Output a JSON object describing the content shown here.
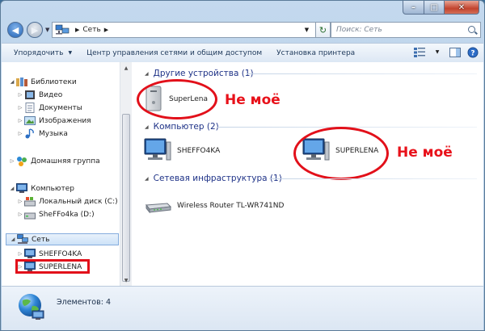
{
  "window": {
    "controls": {
      "minimize": "–",
      "maximize": "□",
      "close": "✕"
    }
  },
  "address_bar": {
    "breadcrumb": [
      "Сеть"
    ],
    "search_placeholder": "Поиск: Сеть"
  },
  "toolbar": {
    "organize_label": "Упорядочить",
    "network_center_label": "Центр управления сетями и общим доступом",
    "add_printer_label": "Установка принтера"
  },
  "nav_pane": {
    "libraries": {
      "label": "Библиотеки",
      "items": [
        {
          "label": "Видео",
          "icon": "video-library-icon"
        },
        {
          "label": "Документы",
          "icon": "documents-library-icon"
        },
        {
          "label": "Изображения",
          "icon": "pictures-library-icon"
        },
        {
          "label": "Музыка",
          "icon": "music-library-icon"
        }
      ]
    },
    "homegroup": {
      "label": "Домашняя группа"
    },
    "computer": {
      "label": "Компьютер",
      "items": [
        {
          "label": "Локальный диск (C:)"
        },
        {
          "label": "SheFFo4ka (D:)"
        }
      ]
    },
    "network": {
      "label": "Сеть",
      "items": [
        {
          "label": "SHEFFO4KA"
        },
        {
          "label": "SUPERLENA"
        }
      ]
    }
  },
  "content": {
    "groups": [
      {
        "title": "Другие устройства (1)",
        "items": [
          {
            "label": "SuperLena",
            "icon": "media-device-icon"
          }
        ]
      },
      {
        "title": "Компьютер (2)",
        "items": [
          {
            "label": "SHEFFO4KA",
            "icon": "computer-icon"
          },
          {
            "label": "SUPERLENA",
            "icon": "computer-icon"
          }
        ]
      },
      {
        "title": "Сетевая инфраструктура (1)",
        "items": [
          {
            "label": "Wireless Router TL-WR741ND",
            "icon": "router-icon"
          }
        ]
      }
    ],
    "annotations": [
      "Не моё",
      "Не моё"
    ]
  },
  "status_bar": {
    "text": "Элементов: 4"
  },
  "colors": {
    "annotation_red": "#e2101a",
    "group_title_blue": "#1e3287"
  }
}
